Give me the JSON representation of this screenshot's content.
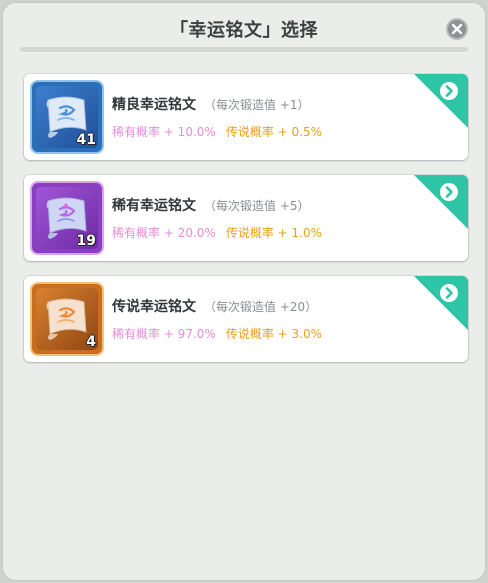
{
  "dialog": {
    "title": "「幸运铭文」选择",
    "colors": {
      "accent": "#2ec4a6",
      "rare_text": "#e48fd6",
      "legend_text": "#e6a11d"
    }
  },
  "items": [
    {
      "name": "精良幸运铭文",
      "bonus": "（每次锻造值 +1）",
      "rare_rate": "稀有概率 + 10.0%",
      "legend_rate": "传说概率 + 0.5%",
      "count": "41",
      "tier_color": "#3f8fd8",
      "icon": "blue-scroll-icon"
    },
    {
      "name": "稀有幸运铭文",
      "bonus": "（每次锻造值 +5）",
      "rare_rate": "稀有概率 + 20.0%",
      "legend_rate": "传说概率 + 1.0%",
      "count": "19",
      "tier_color": "#a955d6",
      "icon": "purple-scroll-icon"
    },
    {
      "name": "传说幸运铭文",
      "bonus": "（每次锻造值 +20）",
      "rare_rate": "稀有概率 + 97.0%",
      "legend_rate": "传说概率 + 3.0%",
      "count": "4",
      "tier_color": "#e58a2e",
      "icon": "orange-scroll-icon"
    }
  ]
}
